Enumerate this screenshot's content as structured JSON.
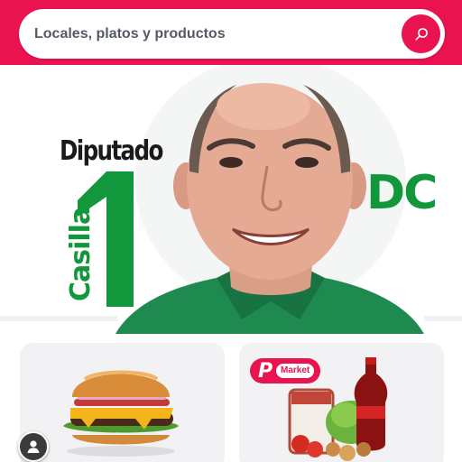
{
  "search": {
    "placeholder": "Locales, platos y productos",
    "button_icon": "search-icon"
  },
  "banner": {
    "title": "Diputado",
    "number": "1",
    "side_text": "Casilla",
    "party": "DC",
    "colors": {
      "accent_green": "#12973d",
      "brand": "#e8134f"
    }
  },
  "categories": [
    {
      "name": "food",
      "image": "burger-image"
    },
    {
      "name": "market",
      "image": "groceries-image",
      "badge_letter": "P",
      "badge_label": "Market"
    }
  ],
  "profile": {
    "icon": "user-icon"
  },
  "theme": {
    "brand": "#e8134f",
    "card_bg": "#f2f2f4"
  }
}
